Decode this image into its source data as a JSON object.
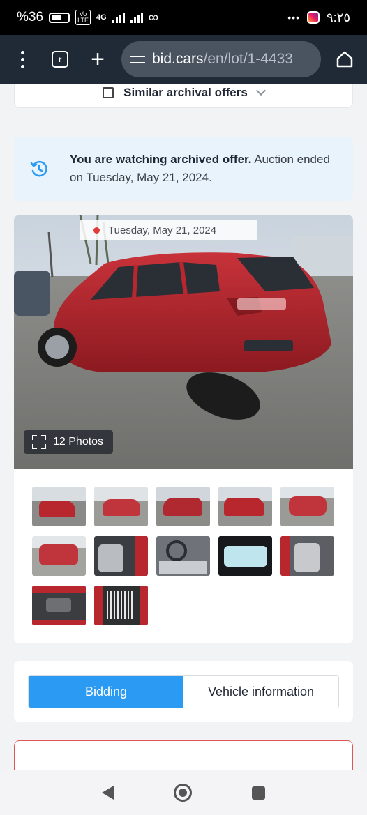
{
  "status_bar": {
    "battery": "%36",
    "network_lte": "Vo LTE",
    "network_gen": "4G",
    "time": "٩:٢٥",
    "more": "•••"
  },
  "browser": {
    "url_domain": "bid.cars",
    "url_path": "/en/lot/1-4433"
  },
  "similar": {
    "label": "Similar archival offers"
  },
  "notice": {
    "bold": "You are watching archived offer.",
    "rest": " Auction ended on Tuesday, May 21, 2024."
  },
  "gallery": {
    "date": "Tuesday, May 21, 2024",
    "photos_label": "12 Photos",
    "thumbnails": [
      "thumb-1",
      "thumb-2",
      "thumb-3",
      "thumb-4",
      "thumb-5",
      "thumb-6",
      "thumb-7",
      "thumb-8",
      "thumb-9",
      "thumb-10",
      "thumb-11",
      "thumb-12"
    ]
  },
  "tabs": {
    "bidding": "Bidding",
    "vehicle_info": "Vehicle information"
  },
  "colors": {
    "accent": "#2b9af3",
    "car": "#b8262e",
    "notice_bg": "#e8f3fc",
    "alert_border": "#e05555"
  }
}
